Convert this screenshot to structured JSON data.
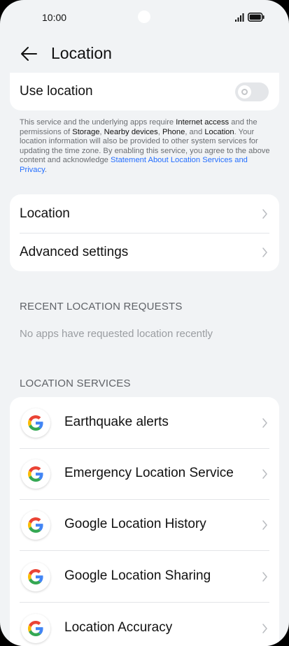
{
  "status": {
    "time": "10:00"
  },
  "header": {
    "title": "Location"
  },
  "use_location": {
    "label": "Use location",
    "enabled": false
  },
  "disclaimer": {
    "p1": "This service and the underlying apps require ",
    "b1": "Internet access",
    "p2": " and the permissions of ",
    "b2": "Storage",
    "p3": ", ",
    "b3": "Nearby devices",
    "p4": ", ",
    "b4": "Phone",
    "p5": ", and ",
    "b5": "Location",
    "p6": ". Your location information will also be provided to other system services for updating the time zone. By enabling this service, you agree to the above content and acknowledge ",
    "link": "Statement About Location Services and Privacy",
    "p7": "."
  },
  "menu": {
    "items": [
      {
        "label": "Location"
      },
      {
        "label": "Advanced settings"
      }
    ]
  },
  "recent": {
    "header": "RECENT LOCATION REQUESTS",
    "empty": "No apps have requested location recently"
  },
  "services": {
    "header": "LOCATION SERVICES",
    "items": [
      {
        "label": "Earthquake alerts",
        "icon": "google-g-icon"
      },
      {
        "label": "Emergency Location Service",
        "icon": "google-g-icon"
      },
      {
        "label": "Google Location History",
        "icon": "google-g-icon"
      },
      {
        "label": "Google Location Sharing",
        "icon": "google-g-icon"
      },
      {
        "label": "Location Accuracy",
        "icon": "google-g-icon"
      }
    ]
  },
  "colors": {
    "background": "#f1f3f5",
    "card": "#ffffff",
    "link": "#256fff",
    "toggle_off": "#e4e6e9"
  }
}
